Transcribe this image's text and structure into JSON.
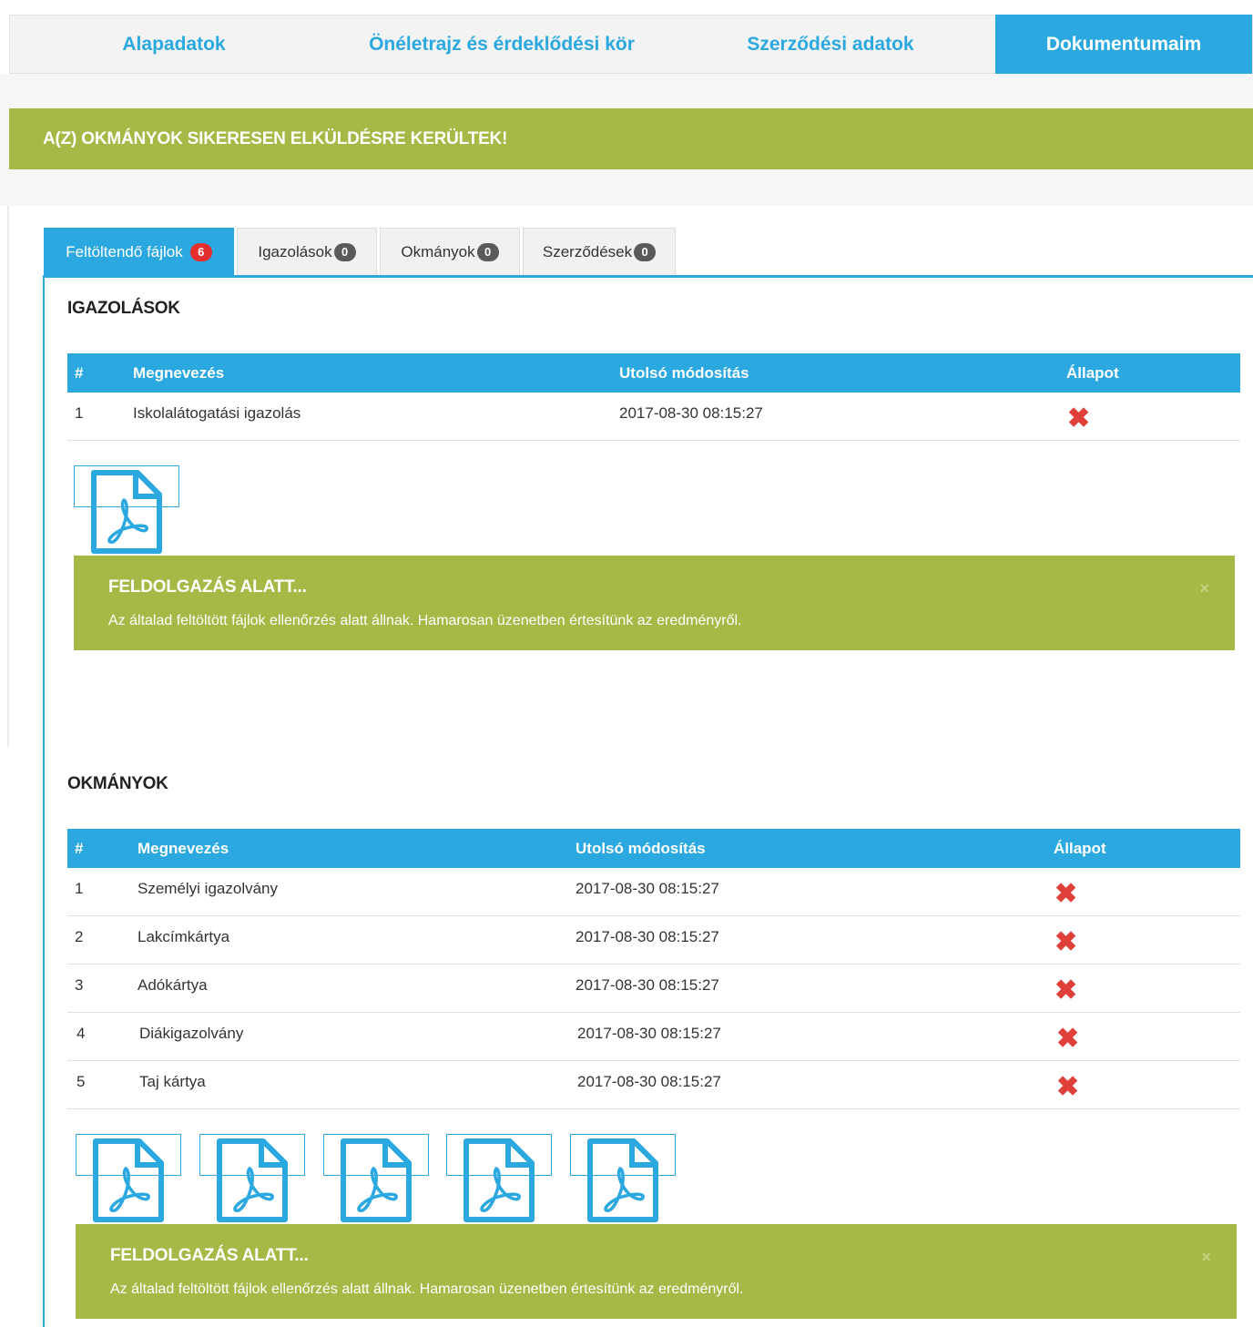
{
  "nav": {
    "items": [
      {
        "label": "Alapadatok"
      },
      {
        "label": "Önéletrajz és érdeklődési kör"
      },
      {
        "label": "Szerződési adatok"
      },
      {
        "label": "Dokumentumaim"
      }
    ]
  },
  "banner": {
    "text": "A(Z) OKMÁNYOK SIKERESEN ELKÜLDÉSRE KERÜLTEK!"
  },
  "tabs": [
    {
      "label": "Feltöltendő fájlok",
      "count": "6"
    },
    {
      "label": "Igazolások",
      "count": "0"
    },
    {
      "label": "Okmányok",
      "count": "0"
    },
    {
      "label": "Szerződések",
      "count": "0"
    }
  ],
  "igazolasok": {
    "title": "IGAZOLÁSOK",
    "headers": {
      "num": "#",
      "name": "Megnevezés",
      "modified": "Utolsó módosítás",
      "status": "Állapot"
    },
    "rows": [
      {
        "num": "1",
        "name": "Iskolalátogatási igazolás",
        "modified": "2017-08-30 08:15:27",
        "status": "✖"
      }
    ],
    "alert": {
      "title": "FELDOLGAZÁS ALATT...",
      "message": "Az általad feltöltött fájlok ellenőrzés alatt állnak. Hamarosan üzenetben értesítünk az eredményről.",
      "close": "×"
    }
  },
  "okmanyok": {
    "title": "OKMÁNYOK",
    "headers": {
      "num": "#",
      "name": "Megnevezés",
      "modified": "Utolsó módosítás",
      "status": "Állapot"
    },
    "rows": [
      {
        "num": "1",
        "name": "Személyi igazolvány",
        "modified": "2017-08-30 08:15:27",
        "status": "✖"
      },
      {
        "num": "2",
        "name": "Lakcímkártya",
        "modified": "2017-08-30 08:15:27",
        "status": "✖"
      },
      {
        "num": "3",
        "name": "Adókártya",
        "modified": "2017-08-30 08:15:27",
        "status": "✖"
      },
      {
        "num": "4",
        "name": "Diákigazolvány",
        "modified": "2017-08-30 08:15:27",
        "status": "✖"
      },
      {
        "num": "5",
        "name": "Taj kártya",
        "modified": "2017-08-30 08:15:27",
        "status": "✖"
      }
    ],
    "alert": {
      "title": "FELDOLGAZÁS ALATT...",
      "message": "Az általad feltöltött fájlok ellenőrzés alatt állnak. Hamarosan üzenetben értesítünk az eredményről.",
      "close": "×"
    }
  },
  "colors": {
    "accent": "#2aa8df",
    "success": "#a8b846",
    "error": "#e0403a"
  },
  "icons": {
    "pdf": "pdf-file-icon",
    "status": "x-mark-icon"
  }
}
